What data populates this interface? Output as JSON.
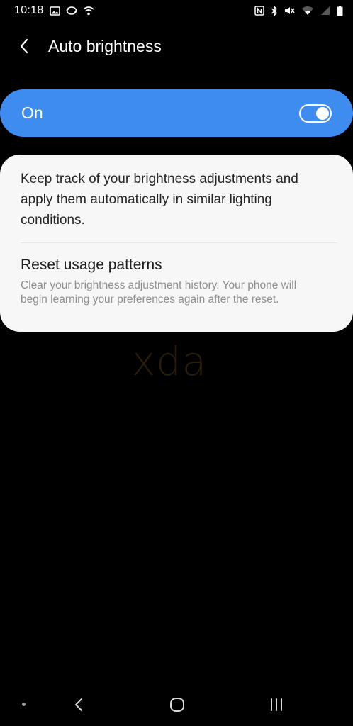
{
  "status_bar": {
    "time": "10:18",
    "left_icons": [
      "gallery-icon",
      "sync-icon",
      "wifi-calling-icon"
    ],
    "right_icons": [
      "nfc-icon",
      "bluetooth-icon",
      "mute-icon",
      "wifi-icon",
      "signal-icon",
      "battery-icon"
    ]
  },
  "header": {
    "back_icon": "chevron-left-icon",
    "title": "Auto brightness"
  },
  "master_switch": {
    "label": "On",
    "checked": true,
    "accent_color": "#3e8cf0"
  },
  "card": {
    "description": "Keep track of your brightness adjustments and apply them automatically in similar lighting conditions.",
    "reset": {
      "title": "Reset usage patterns",
      "summary": "Clear your brightness adjustment history. Your phone will begin learning your preferences again after the reset."
    }
  },
  "watermark": "xda",
  "nav_bar": {
    "items": [
      "dot-indicator",
      "back-icon",
      "home-icon",
      "recents-icon"
    ]
  }
}
